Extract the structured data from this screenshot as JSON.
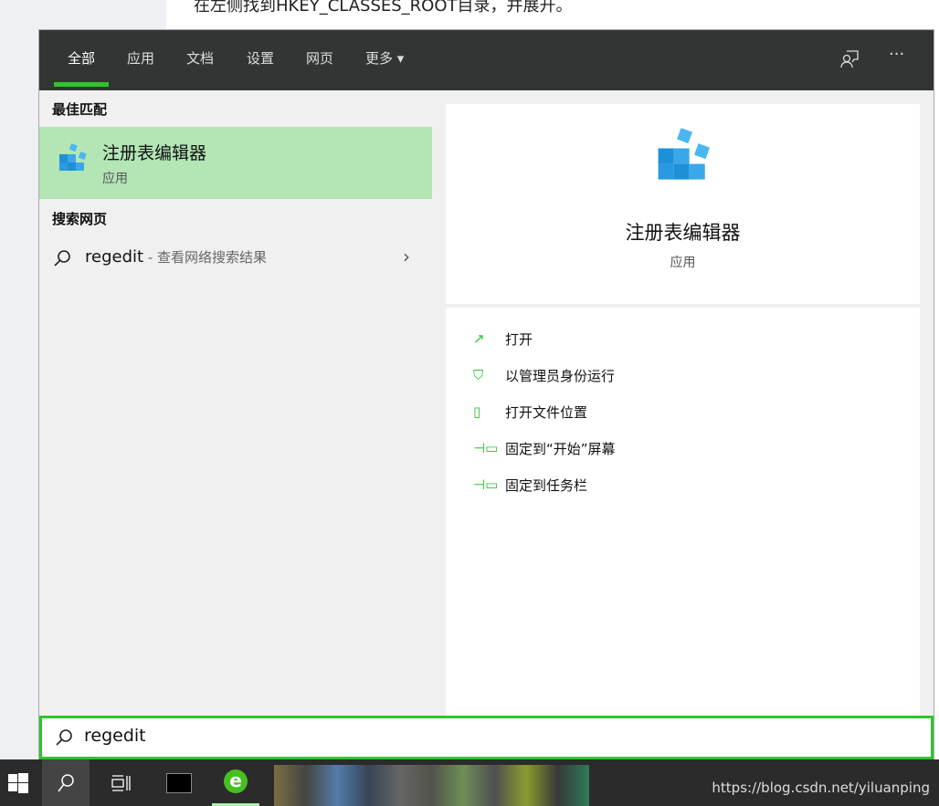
{
  "doc_text": "在左侧找到HKEY_CLASSES_ROOT目录，并展开。",
  "tabs": [
    {
      "label": "全部",
      "active": true
    },
    {
      "label": "应用"
    },
    {
      "label": "文档"
    },
    {
      "label": "设置"
    },
    {
      "label": "网页"
    },
    {
      "label": "更多 ▾"
    }
  ],
  "header_icons": [
    "feedback-icon",
    "more-icon"
  ],
  "best_match": {
    "section": "最佳匹配",
    "title": "注册表编辑器",
    "subtitle": "应用"
  },
  "web": {
    "section": "搜索网页",
    "query": "regedit",
    "desc": " - 查看网络搜索结果"
  },
  "preview": {
    "title": "注册表编辑器",
    "subtitle": "应用"
  },
  "actions": [
    "打开",
    "以管理员身份运行",
    "打开文件位置",
    "固定到“开始”屏幕",
    "固定到任务栏"
  ],
  "search": {
    "value": "regedit"
  },
  "accent": "#2dc52d",
  "watermark": "https://blog.csdn.net/yiluanping"
}
